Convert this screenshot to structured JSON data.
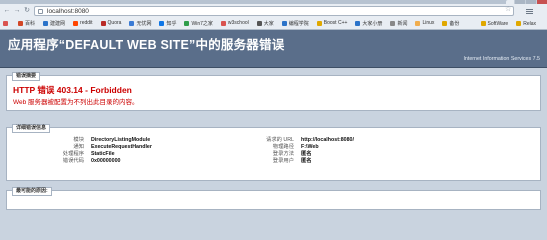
{
  "browser": {
    "url": "localhost:8080",
    "bookmarks": [
      {
        "label": "",
        "color": "#d9534f"
      },
      {
        "label": "百科",
        "color": "#d24726"
      },
      {
        "label": "建建网",
        "color": "#2b73c9"
      },
      {
        "label": "reddit",
        "color": "#ff4500"
      },
      {
        "label": "Quora",
        "color": "#b92b27"
      },
      {
        "label": "无忧网",
        "color": "#3a7bd5"
      },
      {
        "label": "知乎",
        "color": "#0e76e6"
      },
      {
        "label": "Win7之家",
        "color": "#2e9d4a"
      },
      {
        "label": "w3school",
        "color": "#d9534f"
      },
      {
        "label": "大家",
        "color": "#555555"
      },
      {
        "label": "编程学院",
        "color": "#2b73c9"
      },
      {
        "label": "Boost C++",
        "color": "#e0a800"
      },
      {
        "label": "大家小册",
        "color": "#2b73c9"
      },
      {
        "label": "新闻",
        "color": "#888888"
      },
      {
        "label": "Linux",
        "color": "#f0ad4e"
      },
      {
        "label": "备份",
        "color": "#e0a800"
      }
    ],
    "bookmarks_right": [
      {
        "label": "SoftWare",
        "color": "#e0a800"
      },
      {
        "label": "Relax",
        "color": "#e0a800"
      }
    ]
  },
  "header": {
    "title": "应用程序“DEFAULT WEB SITE”中的服务器错误",
    "version": "Internet Information Services 7.5"
  },
  "error_panel": {
    "tab": "错误摘要",
    "title": "HTTP 错误 403.14 - Forbidden",
    "description": "Web 服务器被配置为不列出此目录的内容。"
  },
  "detail_panel": {
    "tab": "详细错误信息",
    "rows": [
      {
        "label": "模块",
        "value": "DirectoryListingModule",
        "label2": "请求的 URL",
        "value2": "http://localhost:8080/"
      },
      {
        "label": "通知",
        "value": "ExecuteRequestHandler",
        "label2": "物理路径",
        "value2": "F:\\Web"
      },
      {
        "label": "处理程序",
        "value": "StaticFile",
        "label2": "登录方法",
        "value2": "匿名"
      },
      {
        "label": "错误代码",
        "value": "0x00000000",
        "label2": "登录用户",
        "value2": "匿名"
      }
    ]
  },
  "causes_panel": {
    "tab": "最可能的原因:"
  }
}
